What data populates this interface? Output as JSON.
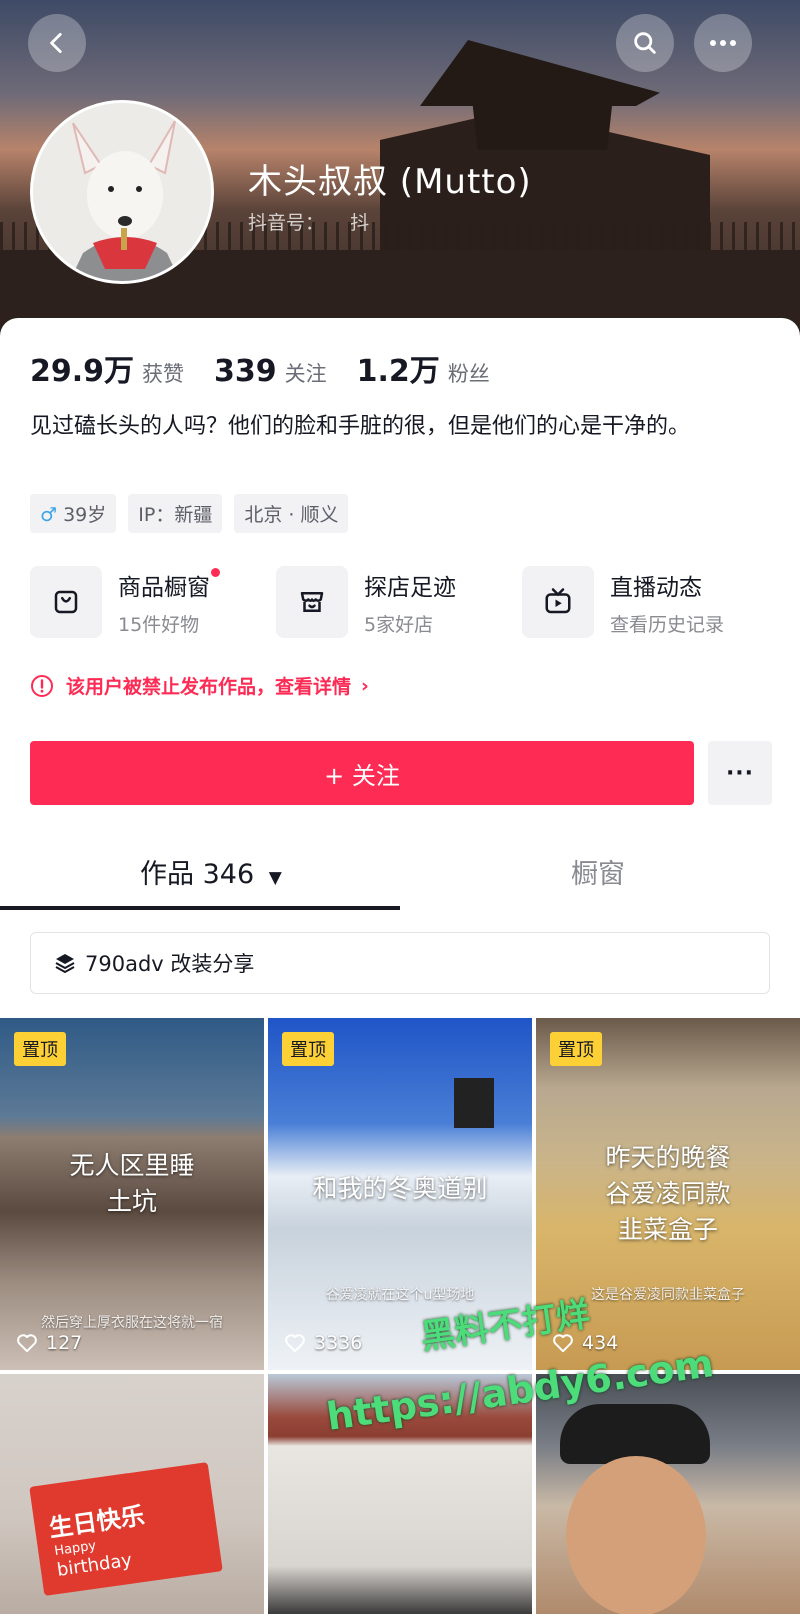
{
  "profile": {
    "name": "木头叔叔 (Mutto)",
    "douyin_id_label": "抖音号：",
    "douyin_id_value": "抖"
  },
  "stats": {
    "likes_value": "29.9万",
    "likes_label": "获赞",
    "following_value": "339",
    "following_label": "关注",
    "followers_value": "1.2万",
    "followers_label": "粉丝"
  },
  "bio": "见过磕长头的人吗？他们的脸和手脏的很，但是他们的心是干净的。",
  "tags": {
    "gender_symbol": "♂",
    "age": "39岁",
    "ip": "IP：新疆",
    "location": "北京 · 顺义"
  },
  "features": [
    {
      "title": "商品橱窗",
      "subtitle": "15件好物",
      "icon": "bag-icon"
    },
    {
      "title": "探店足迹",
      "subtitle": "5家好店",
      "icon": "store-icon"
    },
    {
      "title": "直播动态",
      "subtitle": "查看历史记录",
      "icon": "tv-play-icon"
    }
  ],
  "warning": {
    "text": "该用户被禁止发布作品，查看详情",
    "arrow": "›"
  },
  "actions": {
    "follow_label": "+ 关注",
    "more": "···"
  },
  "tabs": {
    "works_label": "作品 346",
    "works_caret": "▼",
    "showcase_label": "橱窗"
  },
  "collection": {
    "label": "790adv 改装分享",
    "icon": "layers-icon"
  },
  "videos": [
    {
      "pinned": "置顶",
      "caption_lines": [
        "无人区里睡",
        "土坑"
      ],
      "subcaption": "然后穿上厚衣服在这将就一宿",
      "likes": "127"
    },
    {
      "pinned": "置顶",
      "caption_lines": [
        "和我的冬奥道别"
      ],
      "subcaption": "谷爱凌就在这个u型场地",
      "likes": "3336"
    },
    {
      "pinned": "置顶",
      "caption_lines": [
        "昨天的晚餐",
        "谷爱凌同款",
        "韭菜盒子"
      ],
      "subcaption": "这是谷爱凌同款韭菜盒子",
      "likes": "434"
    }
  ],
  "bottom_row": {
    "birthday_card_cn": "生日快乐",
    "birthday_card_en1": "Happy",
    "birthday_card_en2": "birthday"
  },
  "watermark": {
    "line1": "黑料不打烊",
    "line2": "https://abdy6.com"
  },
  "colors": {
    "accent": "#fe2c55",
    "pin": "#fdd035",
    "text": "#161823",
    "muted": "#8a8b91",
    "chip_bg": "#f2f2f4"
  }
}
